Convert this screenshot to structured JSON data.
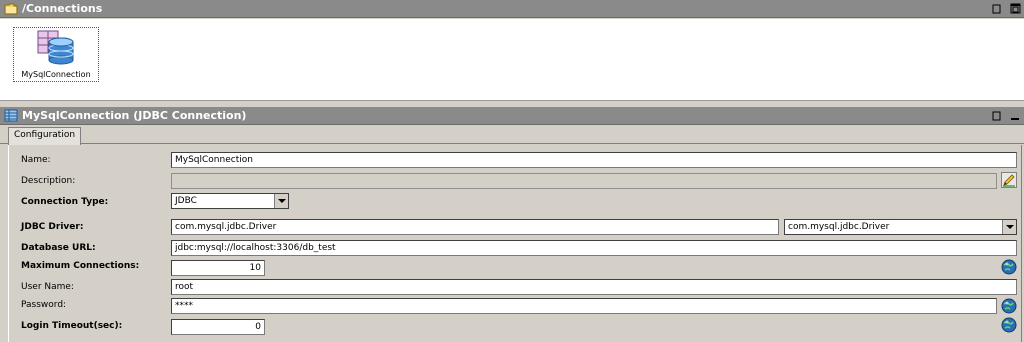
{
  "connections_panel": {
    "title": "/Connections",
    "items": [
      {
        "label": "MySqlConnection"
      }
    ]
  },
  "detail_panel": {
    "title": "MySqlConnection (JDBC Connection)",
    "tab": "Configuration"
  },
  "form": {
    "name": {
      "label": "Name:",
      "value": "MySqlConnection"
    },
    "description": {
      "label": "Description:",
      "value": ""
    },
    "connection_type": {
      "label": "Connection Type:",
      "value": "JDBC"
    },
    "jdbc_driver": {
      "label": "JDBC Driver:",
      "value": "com.mysql.jdbc.Driver",
      "select_value": "com.mysql.jdbc.Driver"
    },
    "database_url": {
      "label": "Database URL:",
      "value": "jdbc:mysql://localhost:3306/db_test"
    },
    "max_connections": {
      "label": "Maximum Connections:",
      "value": "10"
    },
    "user_name": {
      "label": "User Name:",
      "value": "root"
    },
    "password": {
      "label": "Password:",
      "value": "****"
    },
    "login_timeout": {
      "label": "Login Timeout(sec):",
      "value": "0"
    }
  },
  "colors": {
    "titlebar": "#8a8a8a",
    "background": "#d4d0c8",
    "field": "#ffffff",
    "globe": "#2a6fb5"
  },
  "icons": [
    "folder-icon",
    "database-icon",
    "table-icon",
    "restore-icon",
    "maximize-icon",
    "minimize-icon",
    "edit-pencil-icon",
    "globe-icon"
  ]
}
